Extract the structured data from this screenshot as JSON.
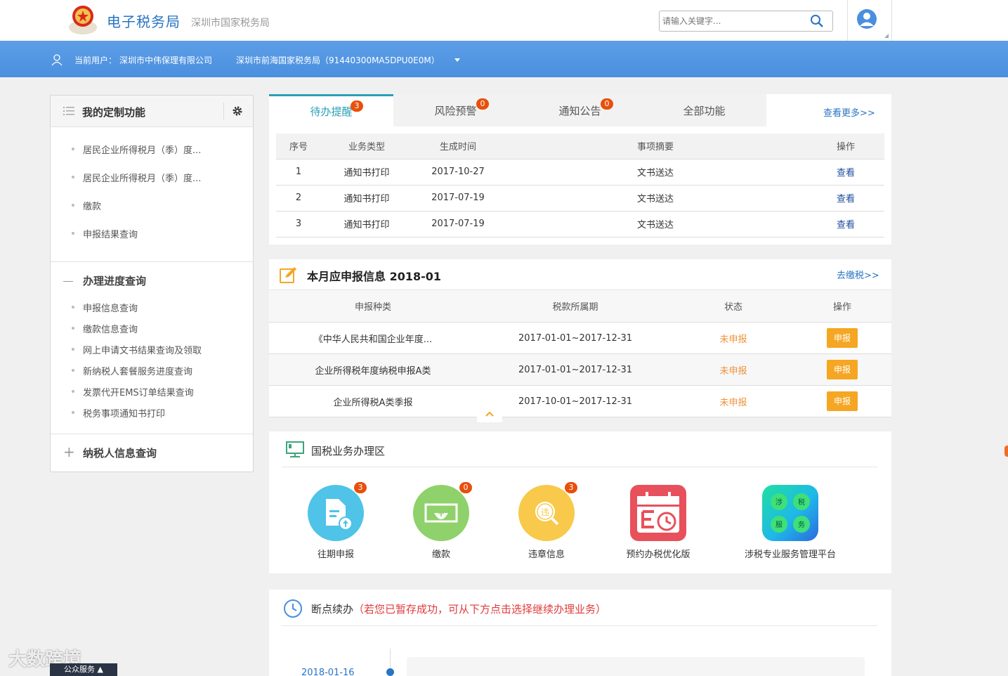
{
  "header": {
    "site_title": "电子税务局",
    "site_sub": "深圳市国家税务局",
    "search_placeholder": "请输入关键字..."
  },
  "userbar": {
    "current_user_label": "当前用户：",
    "company": "深圳市中伟保理有限公司",
    "bureau": "深圳市前海国家税务局（91440300MA5DPU0E0M）"
  },
  "sidebar": {
    "title": "我的定制功能",
    "custom_items": [
      {
        "label": "居民企业所得税月（季）度..."
      },
      {
        "label": "居民企业所得税月（季）度..."
      },
      {
        "label": "缴款"
      },
      {
        "label": "申报结果查询"
      }
    ],
    "progress_title": "办理进度查询",
    "progress_items": [
      {
        "label": "申报信息查询"
      },
      {
        "label": "缴款信息查询"
      },
      {
        "label": "网上申请文书结果查询及领取"
      },
      {
        "label": "新纳税人套餐服务进度查询"
      },
      {
        "label": "发票代开EMS订单结果查询"
      },
      {
        "label": "税务事项通知书打印"
      }
    ],
    "taxpayer_title": "纳税人信息查询"
  },
  "tabs": [
    {
      "label": "待办提醒",
      "badge": "3"
    },
    {
      "label": "风险预警",
      "badge": "0"
    },
    {
      "label": "通知公告",
      "badge": "0"
    },
    {
      "label": "全部功能",
      "badge": ""
    }
  ],
  "more_link": "查看更多>>",
  "todo_table": {
    "headers": [
      "序号",
      "业务类型",
      "生成时间",
      "事项摘要",
      "操作"
    ],
    "rows": [
      {
        "no": "1",
        "type": "通知书打印",
        "time": "2017-10-27",
        "summary": "文书送达",
        "action": "查看"
      },
      {
        "no": "2",
        "type": "通知书打印",
        "time": "2017-07-19",
        "summary": "文书送达",
        "action": "查看"
      },
      {
        "no": "3",
        "type": "通知书打印",
        "time": "2017-07-19",
        "summary": "文书送达",
        "action": "查看"
      }
    ]
  },
  "declare": {
    "title": "本月应申报信息 2018-01",
    "pay_link": "去缴税>>",
    "headers": [
      "申报种类",
      "税款所属期",
      "状态",
      "操作"
    ],
    "rows": [
      {
        "kind": "《中华人民共和国企业年度...",
        "period": "2017-01-01~2017-12-31",
        "status": "未申报",
        "action": "申报"
      },
      {
        "kind": "企业所得税年度纳税申报A类",
        "period": "2017-01-01~2017-12-31",
        "status": "未申报",
        "action": "申报"
      },
      {
        "kind": "企业所得税A类季报",
        "period": "2017-10-01~2017-12-31",
        "status": "未申报",
        "action": "申报"
      }
    ]
  },
  "business": {
    "title": "国税业务办理区",
    "apps": [
      {
        "label": "往期申报",
        "badge": "3",
        "color": "#4fc3e8",
        "icon": "document-upload-icon"
      },
      {
        "label": "缴款",
        "badge": "0",
        "color": "#8fd16a",
        "icon": "payment-yen-icon"
      },
      {
        "label": "违章信息",
        "badge": "3",
        "color": "#f8c94a",
        "icon": "violation-search-icon"
      },
      {
        "label": "预约办税优化版",
        "badge": "",
        "color": "#e8505b",
        "icon": "calendar-clock-icon"
      },
      {
        "label": "涉税专业服务管理平台",
        "badge": "",
        "color": "#1fb8e8",
        "icon": "tax-service-grid-icon"
      }
    ],
    "grid_chars": [
      "涉",
      "税",
      "服",
      "务"
    ]
  },
  "resume": {
    "title": "断点续办",
    "hint": "（若您已暂存成功，可从下方点击选择继续办理业务）",
    "date": "2018-01-16"
  },
  "watermark": "大数跨境",
  "public_service": "公众服务 ▲",
  "colors": {
    "brand_blue": "#2a74c4",
    "bar_blue": "#5d9ee6",
    "active_tab": "#2ba0b8",
    "badge": "#e8500a",
    "declare_button": "#f5a623",
    "status_pending": "#f0913a"
  }
}
